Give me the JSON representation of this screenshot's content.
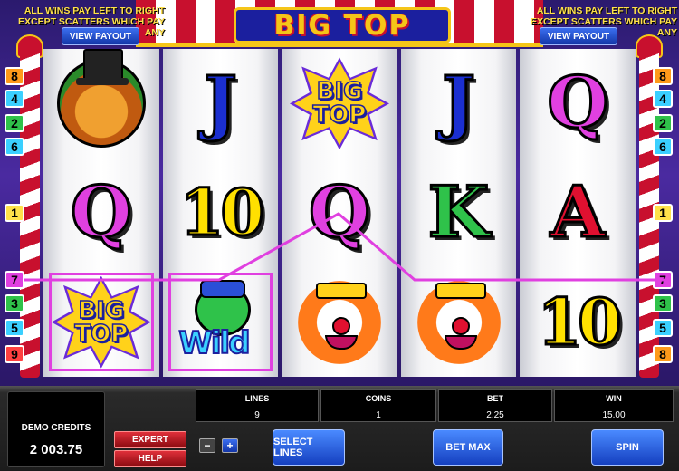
{
  "header": {
    "logo_text": "BIG TOP",
    "rule_left": "ALL WINS PAY LEFT TO RIGHT EXCEPT SCATTERS WHICH PAY ANY",
    "rule_right": "ALL WINS PAY LEFT TO RIGHT EXCEPT SCATTERS WHICH PAY ANY",
    "view_payout_left": "VIEW PAYOUT",
    "view_payout_right": "VIEW PAYOUT"
  },
  "line_indicators": {
    "left": [
      "8",
      "4",
      "2",
      "6",
      "1",
      "7",
      "3",
      "5",
      "9"
    ],
    "right": [
      "8",
      "4",
      "2",
      "6",
      "1",
      "7",
      "3",
      "5",
      "8"
    ]
  },
  "line_colors": {
    "1": "#ffe14a",
    "2": "#2fc24a",
    "3": "#2fc24a",
    "4": "#3ad0ff",
    "5": "#3ad0ff",
    "6": "#3ad0ff",
    "7": "#e040e0",
    "8": "#ff9a1a",
    "9": "#ff4040"
  },
  "reels": [
    [
      {
        "type": "lion-icon"
      },
      {
        "type": "card",
        "text": "Q",
        "color": "#e040e0"
      },
      {
        "type": "bigtop",
        "text": "BIG TOP",
        "win": true
      }
    ],
    [
      {
        "type": "card",
        "text": "J",
        "color": "#1b2fd0"
      },
      {
        "type": "card",
        "text": "10",
        "color": "#ffe000"
      },
      {
        "type": "wild",
        "text": "Wild",
        "win": true
      }
    ],
    [
      {
        "type": "bigtop",
        "text": "BIG TOP"
      },
      {
        "type": "card",
        "text": "Q",
        "color": "#e040e0"
      },
      {
        "type": "clown-icon"
      }
    ],
    [
      {
        "type": "card",
        "text": "J",
        "color": "#1b2fd0"
      },
      {
        "type": "card",
        "text": "K",
        "color": "#2fc24a"
      },
      {
        "type": "clown-icon"
      }
    ],
    [
      {
        "type": "card",
        "text": "Q",
        "color": "#e040e0"
      },
      {
        "type": "card",
        "text": "A",
        "color": "#e01030"
      },
      {
        "type": "card",
        "text": "10",
        "color": "#ffe000"
      }
    ]
  ],
  "winning_line": "7",
  "panel": {
    "credits_label": "DEMO CREDITS",
    "credits_value": "2 003.75",
    "expert_label": "EXPERT",
    "help_label": "HELP",
    "minus_label": "−",
    "plus_label": "+",
    "lines_label": "LINES",
    "lines_value": "9",
    "coins_label": "COINS",
    "coins_value": "1",
    "bet_label": "BET",
    "bet_value": "2.25",
    "win_label": "WIN",
    "win_value": "15.00",
    "select_lines_label": "SELECT LINES",
    "bet_max_label": "BET MAX",
    "spin_label": "SPIN"
  }
}
